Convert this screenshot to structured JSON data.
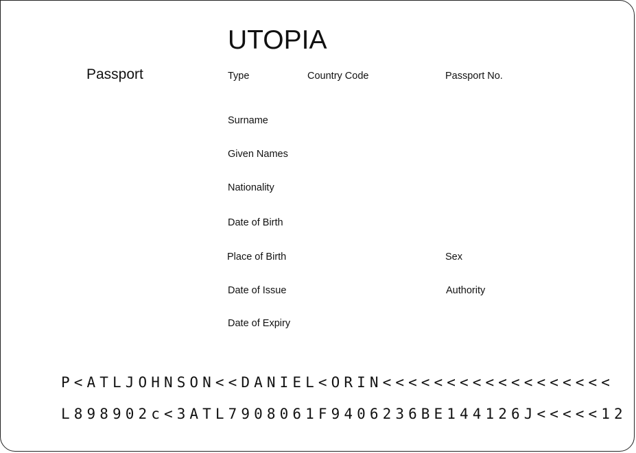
{
  "document": {
    "country": "UTOPIA",
    "doc_type_label": "Passport"
  },
  "fields": {
    "type": "Type",
    "country_code": "Country Code",
    "passport_no": "Passport No.",
    "surname": "Surname",
    "given_names": "Given Names",
    "nationality": "Nationality",
    "date_of_birth": "Date of Birth",
    "place_of_birth": "Place of Birth",
    "sex": "Sex",
    "date_of_issue": "Date of Issue",
    "authority": "Authority",
    "date_of_expiry": "Date of Expiry"
  },
  "mrz": {
    "line1": "P<ATLJOHNSON<<DANIEL<ORIN<<<<<<<<<<<<<<<<<<",
    "line2": "L898902c<3ATL7908061F9406236BE144126J<<<<<12"
  }
}
